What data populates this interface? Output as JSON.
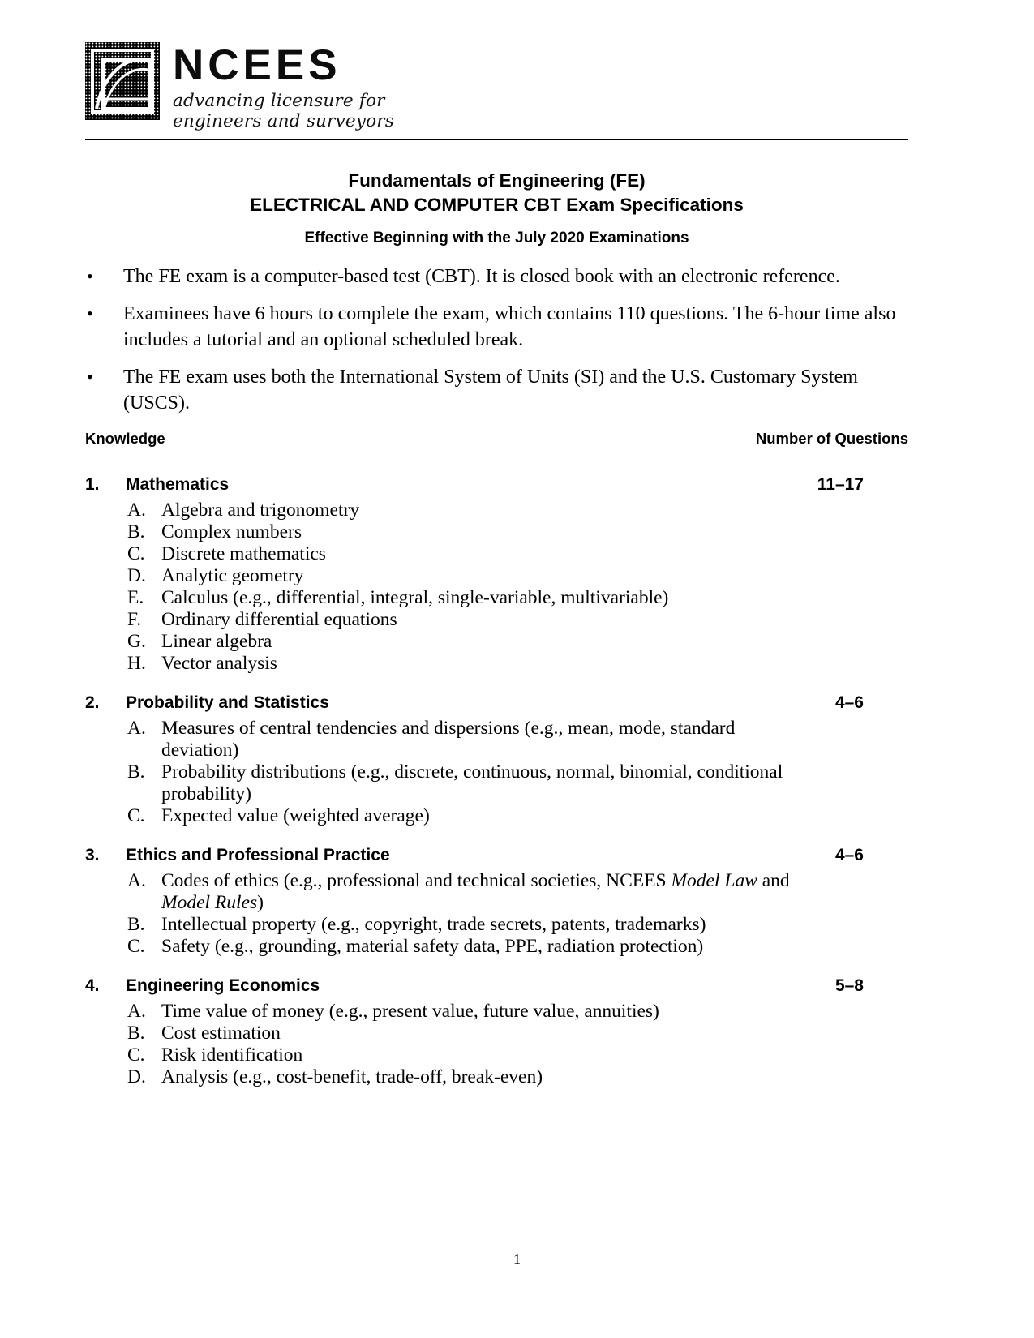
{
  "logo": {
    "name": "NCEES",
    "tagline_line1": "advancing licensure for",
    "tagline_line2": "engineers and surveyors"
  },
  "titles": {
    "line1": "Fundamentals of Engineering (FE)",
    "line2": "ELECTRICAL AND COMPUTER CBT Exam Specifications",
    "line3": "Effective Beginning with the July 2020 Examinations"
  },
  "bullets": [
    "The FE exam is a computer-based test (CBT). It is closed book with an electronic reference.",
    "Examinees have 6 hours to complete the exam, which contains 110 questions. The 6-hour time also includes a tutorial and an optional scheduled break.",
    "The FE exam uses both the International System of Units (SI) and the U.S. Customary System (USCS)."
  ],
  "column_headers": {
    "left": "Knowledge",
    "right": "Number of Questions"
  },
  "sections": [
    {
      "number": "1.",
      "title": "Mathematics",
      "count": "11–17",
      "items": [
        {
          "letter": "A.",
          "text": "Algebra and trigonometry"
        },
        {
          "letter": "B.",
          "text": "Complex numbers"
        },
        {
          "letter": "C.",
          "text": "Discrete mathematics"
        },
        {
          "letter": "D.",
          "text": "Analytic geometry"
        },
        {
          "letter": "E.",
          "text": "Calculus (e.g., differential, integral, single-variable, multivariable)"
        },
        {
          "letter": "F.",
          "text": "Ordinary differential equations"
        },
        {
          "letter": "G.",
          "text": "Linear algebra"
        },
        {
          "letter": "H.",
          "text": "Vector analysis"
        }
      ]
    },
    {
      "number": "2.",
      "title": "Probability and Statistics",
      "count": "4–6",
      "items": [
        {
          "letter": "A.",
          "text": "Measures of central tendencies and dispersions (e.g., mean, mode, standard deviation)"
        },
        {
          "letter": "B.",
          "text": "Probability distributions (e.g., discrete, continuous, normal, binomial, conditional probability)"
        },
        {
          "letter": "C.",
          "text": "Expected value (weighted average)"
        }
      ]
    },
    {
      "number": "3.",
      "title": "Ethics and Professional Practice",
      "count": "4–6",
      "items": [
        {
          "letter": "A.",
          "html": "Codes of ethics (e.g., professional and technical societies, NCEES <i>Model Law</i> and <i>Model Rules</i>)",
          "text": "Codes of ethics (e.g., professional and technical societies, NCEES Model Law and Model Rules)"
        },
        {
          "letter": "B.",
          "text": "Intellectual property (e.g., copyright, trade secrets, patents, trademarks)"
        },
        {
          "letter": "C.",
          "text": "Safety (e.g., grounding, material safety data, PPE, radiation protection)"
        }
      ]
    },
    {
      "number": "4.",
      "title": "Engineering Economics",
      "count": "5–8",
      "items": [
        {
          "letter": "A.",
          "text": "Time value of money (e.g., present value, future value, annuities)"
        },
        {
          "letter": "B.",
          "text": "Cost estimation"
        },
        {
          "letter": "C.",
          "text": "Risk identification"
        },
        {
          "letter": "D.",
          "text": "Analysis (e.g., cost-benefit, trade-off, break-even)"
        }
      ]
    }
  ],
  "footer": {
    "page_number": "1"
  },
  "bullet_glyph": "•"
}
